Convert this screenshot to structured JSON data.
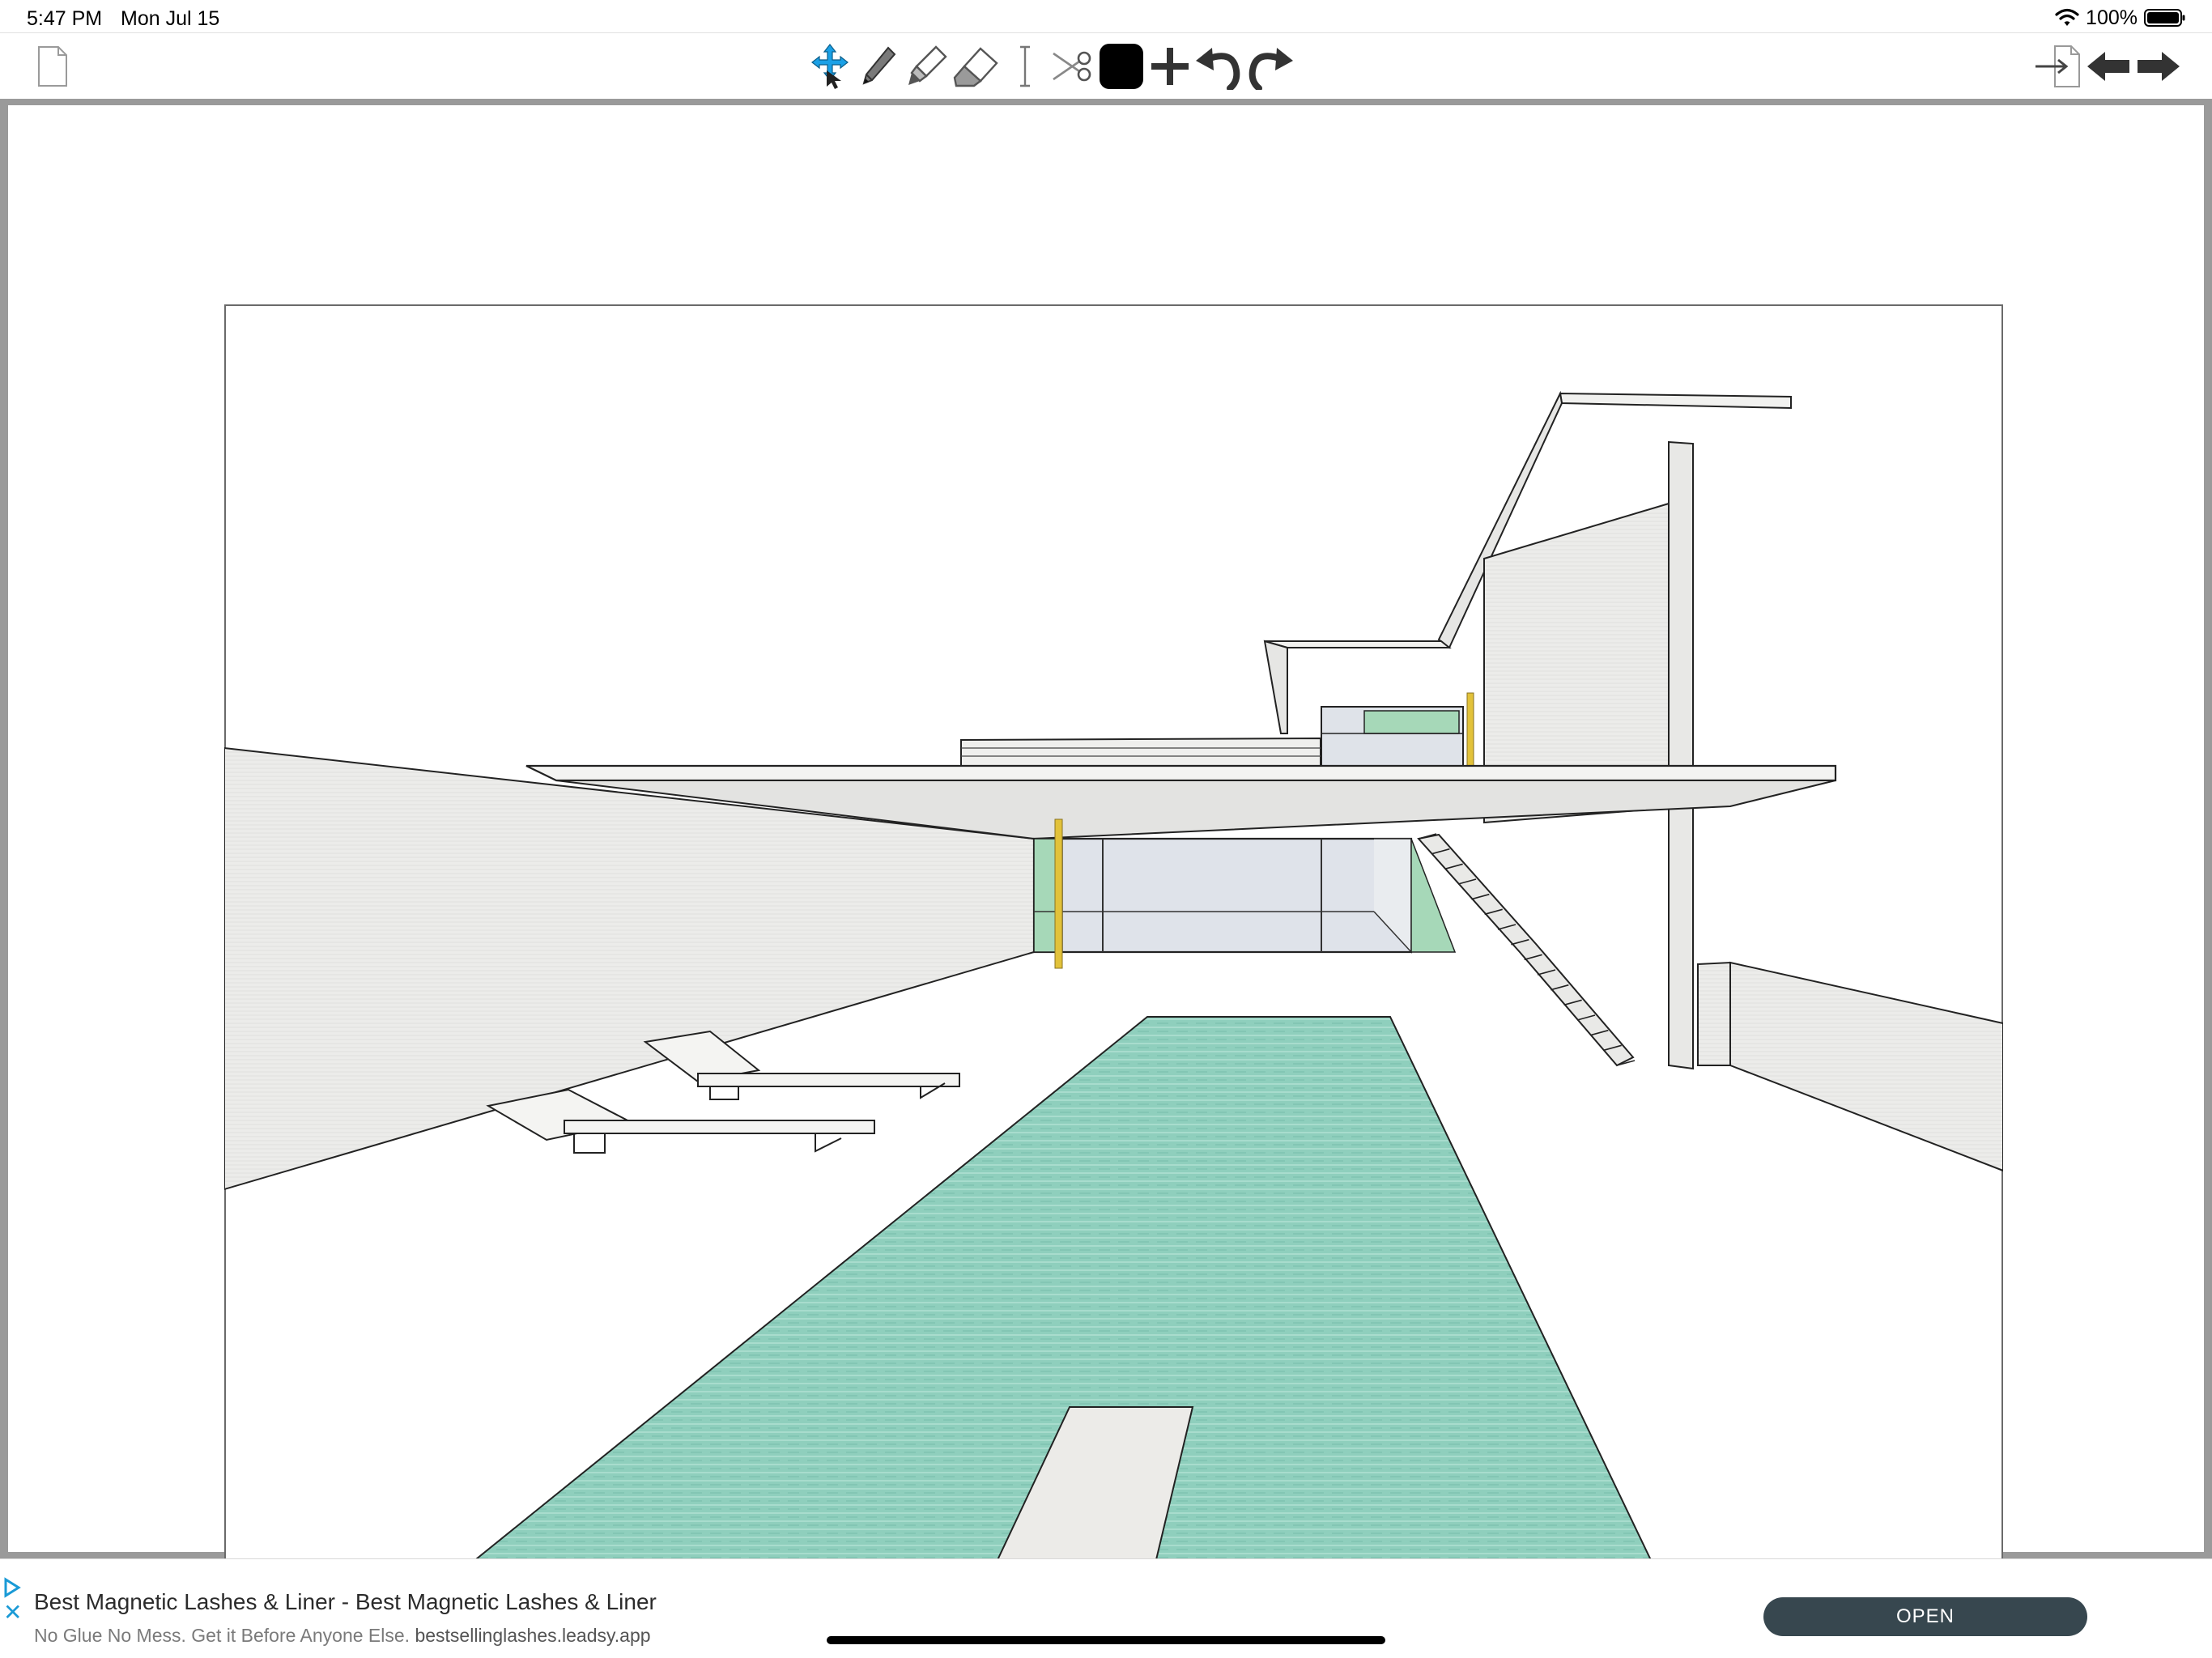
{
  "status_bar": {
    "time": "5:47 PM",
    "date": "Mon Jul 15",
    "battery": "100%",
    "icons": [
      "wifi-icon",
      "battery-icon"
    ]
  },
  "toolbar": {
    "left_tools": [
      "new-page-icon"
    ],
    "center_tools": [
      "move-tool-icon",
      "pencil-tool-icon",
      "marker-tool-icon",
      "eraser-tool-icon",
      "text-tool-icon",
      "scissors-tool-icon",
      "color-swatch",
      "add-icon",
      "undo-icon",
      "redo-icon"
    ],
    "right_tools": [
      "export-page-icon",
      "previous-page-icon",
      "next-page-icon"
    ],
    "selected_color": "#000000",
    "move_tool_color": "#1aa0e6"
  },
  "canvas": {
    "frame_color": "#9a9a9a",
    "paper_color": "#ffffff",
    "drawing_subject": "architectural-sketch",
    "pool_color": "#8ccdbb",
    "accent_yellow": "#e2c23a",
    "glass_green": "#a6d8b8"
  },
  "ad": {
    "title": "Best Magnetic Lashes & Liner - Best Magnetic Lashes & Liner",
    "description": "No Glue No Mess. Get it Before Anyone Else.",
    "domain": "bestsellinglashes.leadsy.app",
    "cta": "OPEN",
    "cta_color": "#37474f"
  }
}
